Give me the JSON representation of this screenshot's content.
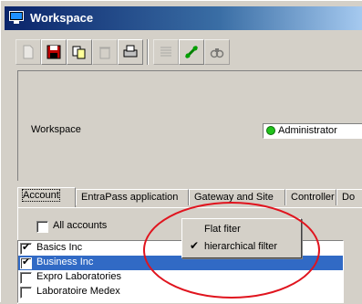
{
  "window": {
    "title": "Workspace"
  },
  "toolbar": {
    "buttons": [
      {
        "icon": "new-icon"
      },
      {
        "icon": "save-icon"
      },
      {
        "icon": "copy-icon"
      },
      {
        "icon": "delete-icon"
      },
      {
        "icon": "print-icon"
      },
      {
        "icon": "list-icon"
      },
      {
        "icon": "link-icon"
      },
      {
        "icon": "search-icon"
      }
    ]
  },
  "workspace": {
    "label": "Workspace",
    "value": "Administrator",
    "status_color": "#21c21b"
  },
  "tabs": [
    "Account",
    "EntraPass application",
    "Gateway and Site",
    "Controller",
    "Do"
  ],
  "filter": {
    "all_accounts_label": "All accounts",
    "all_accounts_checked": false
  },
  "accounts": [
    {
      "label": "Basics Inc",
      "checked": true,
      "selected": false
    },
    {
      "label": "Business Inc",
      "checked": true,
      "selected": true
    },
    {
      "label": "Expro Laboratories",
      "checked": false,
      "selected": false
    },
    {
      "label": "Laboratoire Medex",
      "checked": false,
      "selected": false
    }
  ],
  "context_menu": {
    "items": [
      {
        "label": "Flat fiter",
        "checked": false
      },
      {
        "label": "hierarchical filter",
        "checked": true
      }
    ]
  },
  "colors": {
    "selection": "#316ac5",
    "annotation": "#e0141e"
  }
}
